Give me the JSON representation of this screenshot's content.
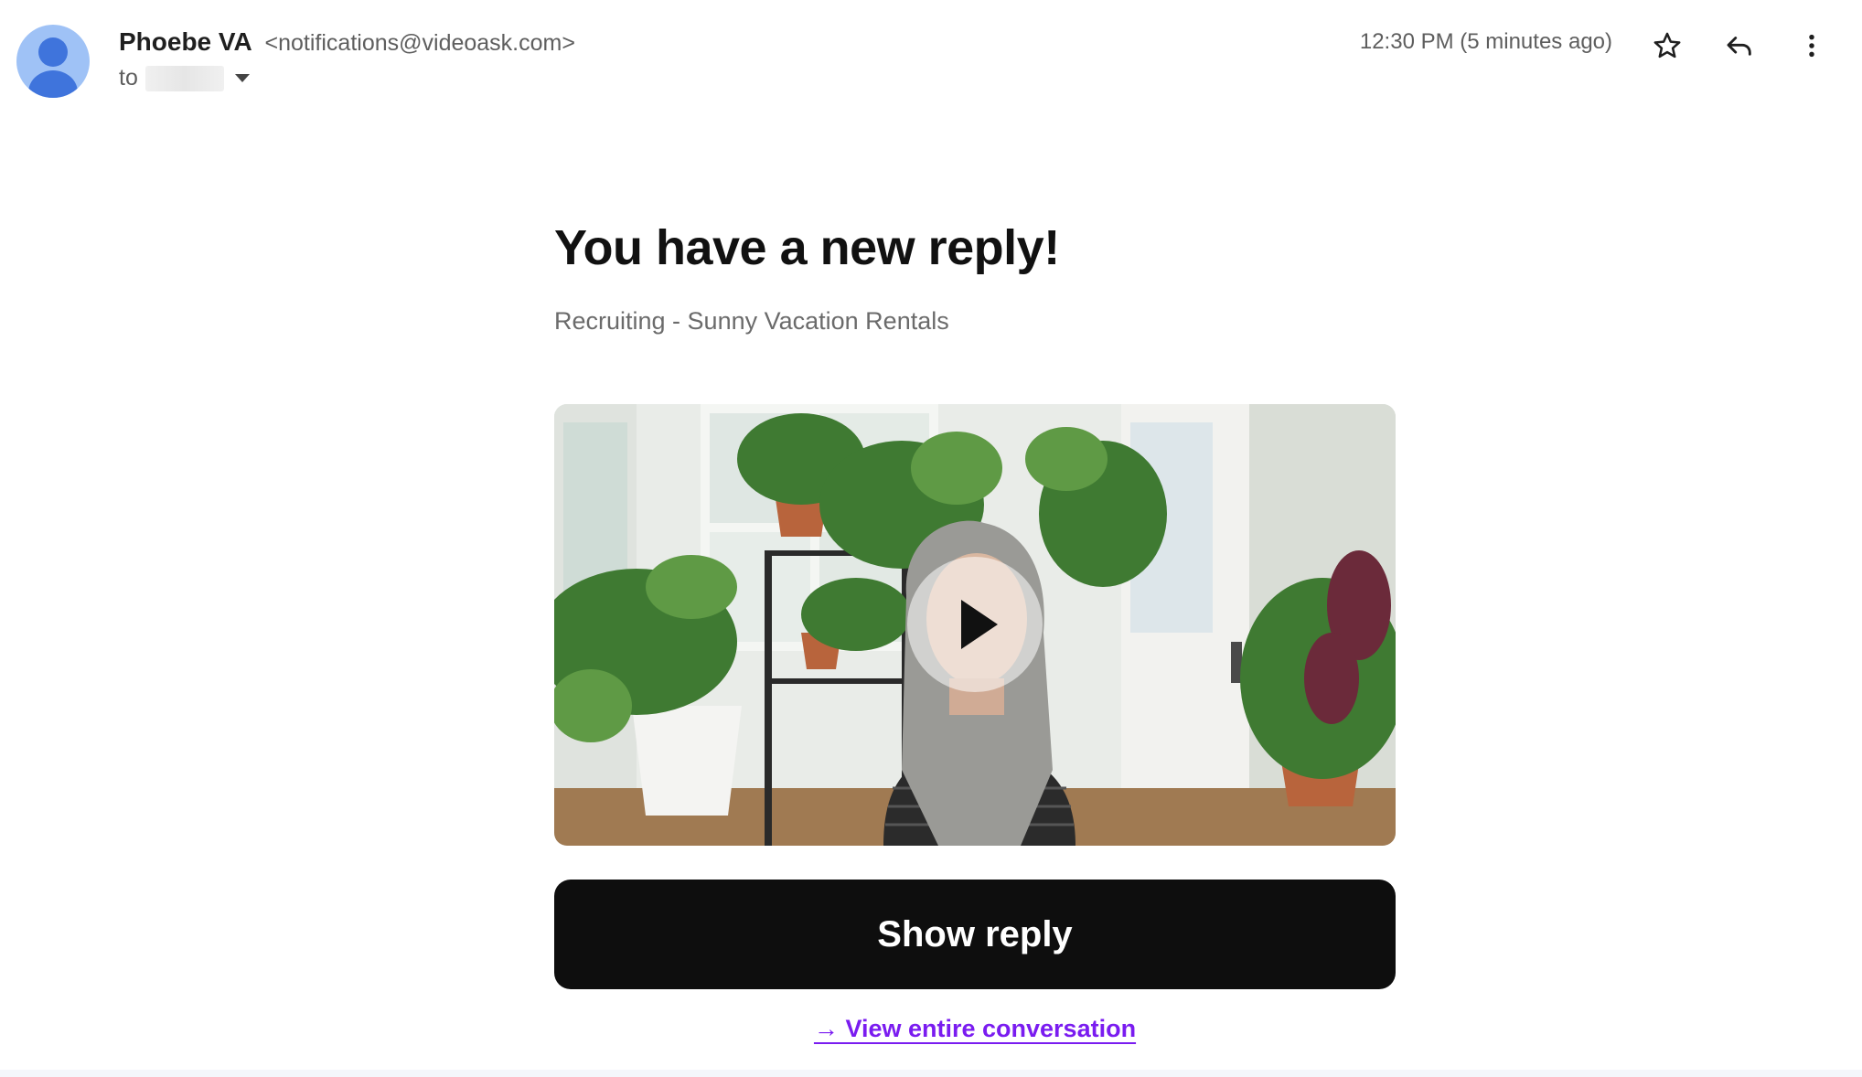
{
  "header": {
    "sender_name": "Phoebe VA",
    "sender_email": "<notifications@videoask.com>",
    "to_label": "to",
    "timestamp": "12:30 PM (5 minutes ago)",
    "icons": {
      "star": "star-icon",
      "reply": "reply-icon",
      "more": "more-vert-icon",
      "expand": "chevron-down-icon"
    }
  },
  "email": {
    "headline": "You have a new reply!",
    "subtitle": "Recruiting - Sunny Vacation Rentals",
    "video_icon": "play-icon",
    "cta_label": "Show reply",
    "link_label": "→ View entire conversation"
  },
  "colors": {
    "avatar_bg": "#9fc2f6",
    "avatar_fg": "#3f74dc",
    "cta_bg": "#0e0e0e",
    "link": "#7a1cf0"
  }
}
